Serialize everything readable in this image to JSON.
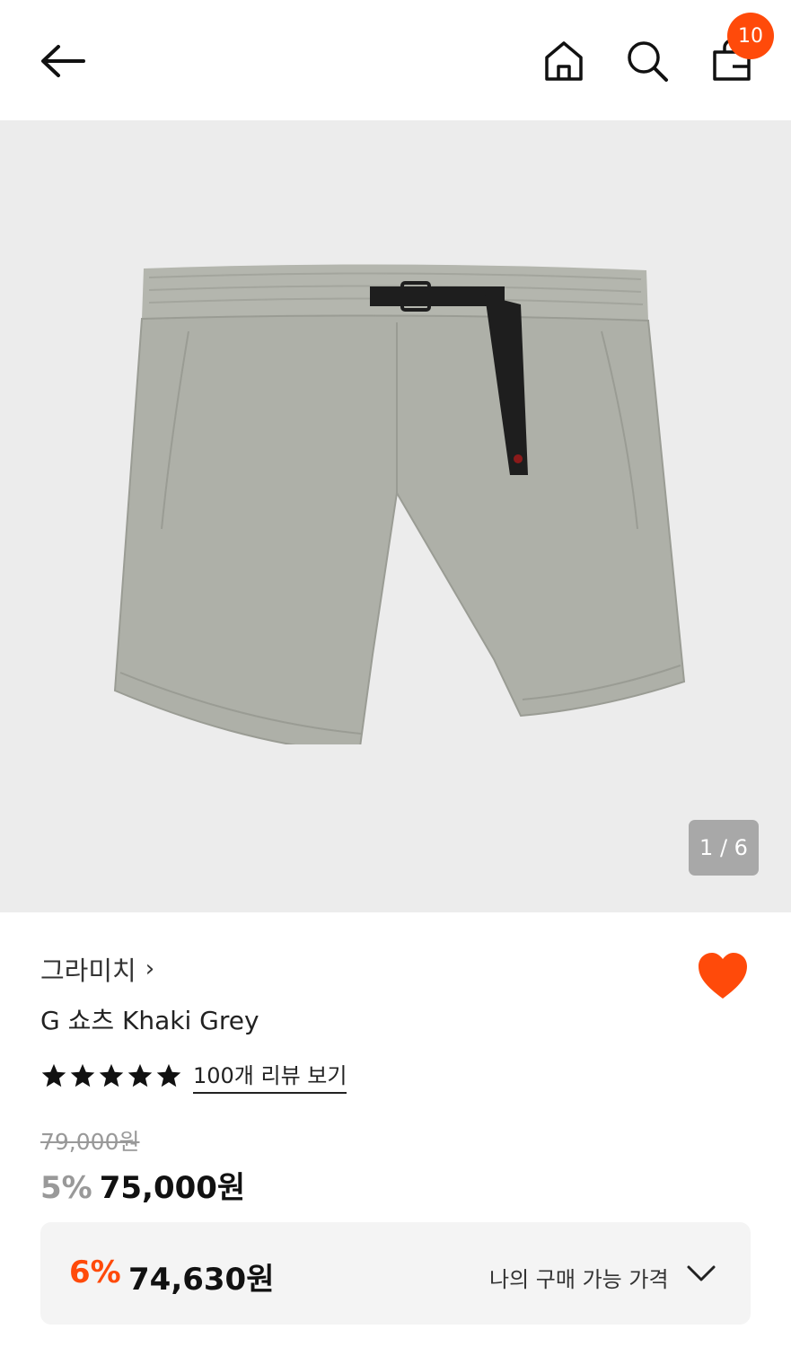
{
  "header": {
    "back_icon": "arrow-left-icon",
    "home_icon": "home-icon",
    "search_icon": "search-icon",
    "cart_icon": "shopping-bag-icon",
    "cart_count": "10"
  },
  "gallery": {
    "image": "grey khaki belted shorts product photo",
    "counter": "1 / 6"
  },
  "product": {
    "brand": "그라미치",
    "brand_chevron": "›",
    "title": "G 쇼츠 Khaki Grey",
    "rating_stars": 5,
    "reviews_link": "100개 리뷰 보기",
    "original_price": "79,000원",
    "discount": "5%",
    "price": "75,000원",
    "liked": true
  },
  "best_price": {
    "discount": "6%",
    "price": "74,630원",
    "label": "나의 구매 가능 가격"
  },
  "colors": {
    "accent": "#ff4a0a",
    "gallery_bg": "#ececec",
    "box_bg": "#f4f4f4"
  }
}
